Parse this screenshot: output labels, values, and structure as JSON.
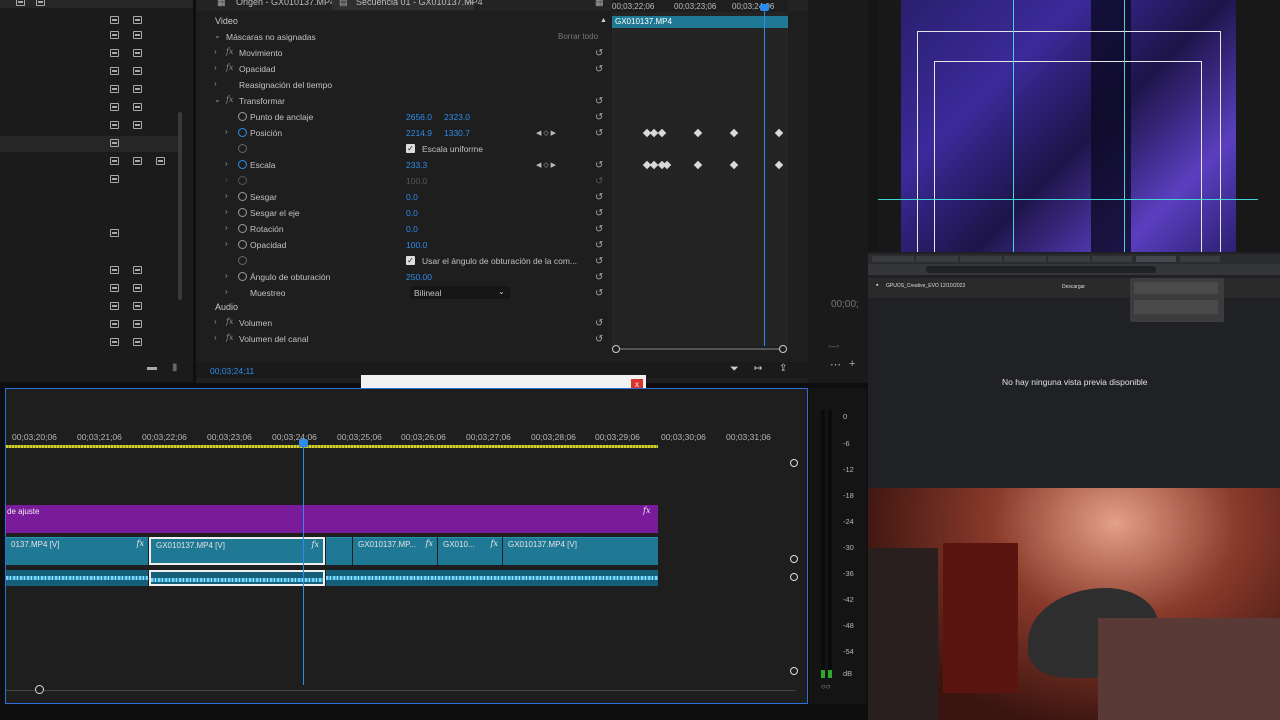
{
  "project_panel": {
    "rows": 12
  },
  "effect_controls": {
    "tab_source": "Origen - GX010137.MP4",
    "tab_sequence": "Secuencia 01 - GX010137.MP4",
    "clip_name": "GX010137.MP4",
    "ruler_times": [
      "00;03;22;06",
      "00;03;23;06",
      "00;03;24;06"
    ],
    "section_video": "Video",
    "masks_label": "Máscaras no asignadas",
    "clear_all": "Borrar todo",
    "movement": "Movimiento",
    "opacity": "Opacidad",
    "time_remap": "Reasignación del tiempo",
    "transform": "Transformar",
    "anchor_point": "Punto de anclaje",
    "anchor_x": "2656.0",
    "anchor_y": "2323.0",
    "position": "Posición",
    "position_x": "2214.9",
    "position_y": "1330.7",
    "uniform_scale": "Escala uniforme",
    "scale": "Escala",
    "scale_value": "233.3",
    "scale_width_value": "100.0",
    "skew": "Sesgar",
    "skew_value": "0.0",
    "skew_axis": "Sesgar el eje",
    "skew_axis_value": "0.0",
    "rotation": "Rotación",
    "rotation_value": "0.0",
    "opacity2": "Opacidad",
    "opacity_value": "100.0",
    "use_shutter": "Usar el ángulo de obturación de la com...",
    "shutter_angle": "Ángulo de obturación",
    "shutter_angle_value": "250.00",
    "sampling": "Muestreo",
    "sampling_value": "Bilineal",
    "section_audio": "Audio",
    "volume": "Volumen",
    "channel_volume": "Volumen del canal",
    "current_time": "00;03;24;11",
    "side_timecode": "00;00;"
  },
  "toolbar": {
    "close": "x"
  },
  "timeline": {
    "ruler": [
      "00;03;20;06",
      "00;03;21;06",
      "00;03;22;06",
      "00;03;23;06",
      "00;03;24;06",
      "00;03;25;06",
      "00;03;26;06",
      "00;03;27;06",
      "00;03;28;06",
      "00;03;29;06",
      "00;03;30;06",
      "00;03;31;06"
    ],
    "adjustment_label": "de ajuste",
    "clips": [
      "0137.MP4 [V]",
      "GX010137.MP4 [V]",
      "GX010137.MP...",
      "GX010...",
      "GX010137.MP4 [V]"
    ],
    "fx": "fx"
  },
  "meters": {
    "scale": [
      "0",
      "-6",
      "-12",
      "-18",
      "-24",
      "-30",
      "-36",
      "-42",
      "-48",
      "-54"
    ],
    "unit": "dB"
  },
  "browser": {
    "no_preview": "No hay ninguna vista previa disponible",
    "file_title": "GPUOS_Creative_EVO 12/10/2023",
    "download": "Descargar"
  }
}
